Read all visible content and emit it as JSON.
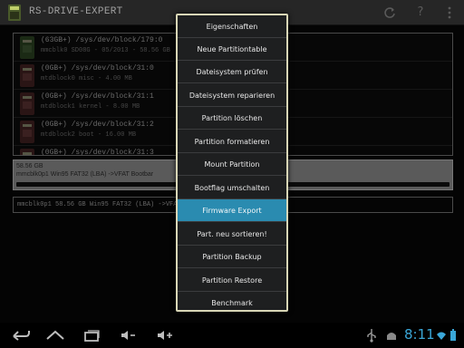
{
  "app": {
    "title": "RS-DRIVE-EXPERT"
  },
  "actionbar": {
    "refresh_icon": "refresh-icon",
    "help_label": "?",
    "overflow_icon": "overflow-icon"
  },
  "devices": [
    {
      "name": "(63GB+) /sys/dev/block/179:0",
      "sub": "mmcblk0   SD08G - 05/2013 - 58.56 GB",
      "icon": "sd-card-icon"
    },
    {
      "name": "(0GB+) /sys/dev/block/31:0",
      "sub": "mtdblock0   misc  -  4.00 MB",
      "icon": "mtd-icon"
    },
    {
      "name": "(0GB+) /sys/dev/block/31:1",
      "sub": "mtdblock1   kernel  -  8.00 MB",
      "icon": "mtd-icon"
    },
    {
      "name": "(0GB+) /sys/dev/block/31:2",
      "sub": "mtdblock2   boot  -  16.00 MB",
      "icon": "mtd-icon"
    },
    {
      "name": "(0GB+) /sys/dev/block/31:3",
      "sub": "",
      "icon": "mtd-icon"
    }
  ],
  "partition": {
    "size": "58.56 GB",
    "desc": "mmcblk0p1  Win95 FAT32 (LBA) ->VFAT Bootbar"
  },
  "info": {
    "text": "mmcblk0p1  58.56 GB  Win95 FAT32 (LBA) ->VFAT Bootbar"
  },
  "menu": {
    "items": [
      "Eigenschaften",
      "Neue Partitiontable",
      "Dateisystem prüfen",
      "Dateisystem reparieren",
      "Partition löschen",
      "Partition formatieren",
      "Mount Partition",
      "Bootflag umschalten",
      "Firmware Export",
      "Part. neu sortieren!",
      "Partition Backup",
      "Partition Restore",
      "Benchmark"
    ],
    "selected_index": 8
  },
  "sysbar": {
    "time": "8:11"
  },
  "colors": {
    "accent": "#2a8bb0",
    "menu_border": "#d8d6b6",
    "clock": "#3aa7d8",
    "actionbar": "#262626"
  }
}
